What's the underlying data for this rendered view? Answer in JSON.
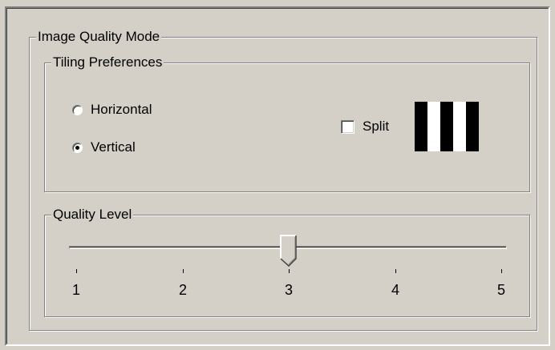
{
  "image_quality_group": {
    "legend": "Image Quality Mode",
    "tiling_preferences": {
      "legend": "Tiling Preferences",
      "orientation_options": [
        {
          "label": "Horizontal",
          "checked": false
        },
        {
          "label": "Vertical",
          "checked": true
        }
      ],
      "split": {
        "label": "Split",
        "checked": false
      },
      "tile_preview_colors": [
        "#000000",
        "#ffffff",
        "#000000",
        "#ffffff",
        "#000000"
      ]
    },
    "quality_level": {
      "legend": "Quality Level",
      "min": 1,
      "max": 5,
      "value": 3,
      "ticks": [
        "1",
        "2",
        "3",
        "4",
        "5"
      ]
    }
  }
}
